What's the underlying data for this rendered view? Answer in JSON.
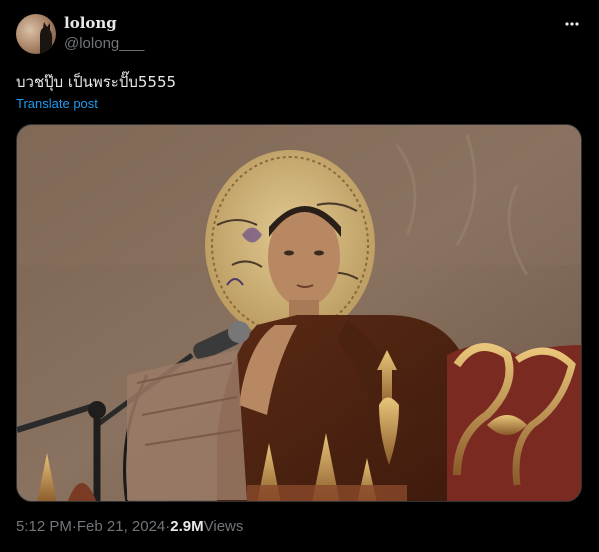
{
  "author": {
    "display_name": "lolong",
    "handle": "@lolong___",
    "avatar_icon": "cat-silhouette-avatar"
  },
  "post": {
    "text": "บวชปุ๊บ เป็นพระปั๊บ5555",
    "translate_label": "Translate post",
    "more_icon": "more-horizontal-icon"
  },
  "media": {
    "alt": "photo"
  },
  "meta": {
    "time": "5:12 PM",
    "separator1": " · ",
    "date": "Feb 21, 2024",
    "separator2": " · ",
    "views_count": "2.9M",
    "views_label": " Views"
  },
  "colors": {
    "background": "#000000",
    "text_primary": "#e7e9ea",
    "text_secondary": "#71767b",
    "link": "#1d9bf0"
  }
}
